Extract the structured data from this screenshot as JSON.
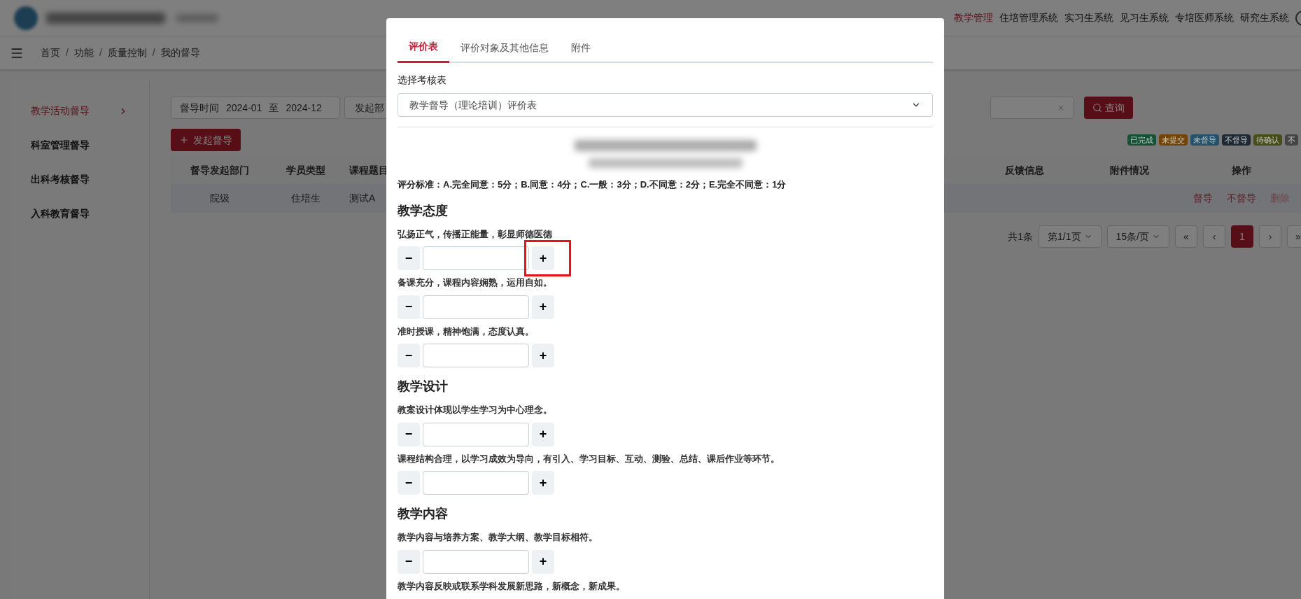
{
  "top_nav": [
    {
      "label": "教学管理",
      "selected": true
    },
    {
      "label": "住培管理系统",
      "selected": false
    },
    {
      "label": "实习生系统",
      "selected": false
    },
    {
      "label": "见习生系统",
      "selected": false
    },
    {
      "label": "专培医师系统",
      "selected": false
    },
    {
      "label": "研究生系统",
      "selected": false
    }
  ],
  "breadcrumb": {
    "items": [
      "首页",
      "功能",
      "质量控制",
      "我的督导"
    ],
    "separator": "/"
  },
  "sidebar": {
    "items": [
      {
        "label": "教学活动督导",
        "selected": true
      },
      {
        "label": "科室管理督导",
        "selected": false
      },
      {
        "label": "出科考核督导",
        "selected": false
      },
      {
        "label": "入科教育督导",
        "selected": false
      }
    ]
  },
  "filters": {
    "time_label": "督导时间",
    "from": "2024-01",
    "to_label": "至",
    "to": "2024-12",
    "department_label": "发起部",
    "search_button": "查询"
  },
  "new_button": "发起督导",
  "legend": [
    {
      "label": "已完成",
      "color": "#135234"
    },
    {
      "label": "未提交",
      "color": "#744406"
    },
    {
      "label": "未督导",
      "color": "#25516b"
    },
    {
      "label": "不督导",
      "color": "#1f2933"
    },
    {
      "label": "待确认",
      "color": "#464d17"
    },
    {
      "label": "不",
      "color": "#454545"
    }
  ],
  "table": {
    "columns": [
      "督导发起部门",
      "学员类型",
      "课程题目",
      "反馈信息",
      "附件情况",
      "操作"
    ],
    "rows": [
      {
        "cells": [
          "院级",
          "住培生",
          "测试A"
        ],
        "actions": [
          "督导",
          "不督导",
          "删除"
        ]
      }
    ]
  },
  "pagination": {
    "total": "共1条",
    "page": "第1/1页",
    "size": "15条/页",
    "first": "«",
    "prev": "‹",
    "pages": [
      {
        "label": "1",
        "selected": true
      }
    ],
    "next": "›",
    "last": "»"
  },
  "modal": {
    "tabs": [
      {
        "label": "评价表",
        "selected": true
      },
      {
        "label": "评价对象及其他信息",
        "selected": false
      },
      {
        "label": "附件",
        "selected": false
      }
    ],
    "select_label": "选择考核表",
    "select_value": "教学督导（理论培训）评价表",
    "criteria": "评分标准：A.完全同意：5分；B.同意：4分；C.一般：3分；D.不同意：2分；E.完全不同意：1分",
    "sections": [
      {
        "title": "教学态度",
        "items": [
          {
            "kind": "stepper",
            "text": "弘扬正气，传播正能量，彰显师德医德",
            "minus": "−",
            "plus": "+",
            "value": "",
            "highlighted": true
          },
          {
            "kind": "stepper",
            "text": "备课充分，课程内容娴熟，运用自如。",
            "minus": "−",
            "plus": "+",
            "value": "",
            "highlighted": false
          },
          {
            "kind": "stepper",
            "text": "准时授课，精神饱满，态度认真。",
            "minus": "−",
            "plus": "+",
            "value": "",
            "highlighted": false
          }
        ]
      },
      {
        "title": "教学设计",
        "items": [
          {
            "kind": "stepper",
            "text": "教案设计体现以学生学习为中心理念。",
            "minus": "−",
            "plus": "+",
            "value": "",
            "highlighted": false
          },
          {
            "kind": "stepper",
            "text": "课程结构合理，以学习成效为导向，有引入、学习目标、互动、测验、总结、课后作业等环节。",
            "minus": "−",
            "plus": "+",
            "value": "",
            "highlighted": false
          }
        ]
      },
      {
        "title": "教学内容",
        "items": [
          {
            "kind": "stepper",
            "text": "教学内容与培养方案、教学大纲、教学目标相符。",
            "minus": "−",
            "plus": "+",
            "value": "",
            "highlighted": false
          },
          {
            "kind": "text",
            "text": "教学内容反映或联系学科发展新思路，新概念，新成果。"
          }
        ]
      }
    ]
  }
}
